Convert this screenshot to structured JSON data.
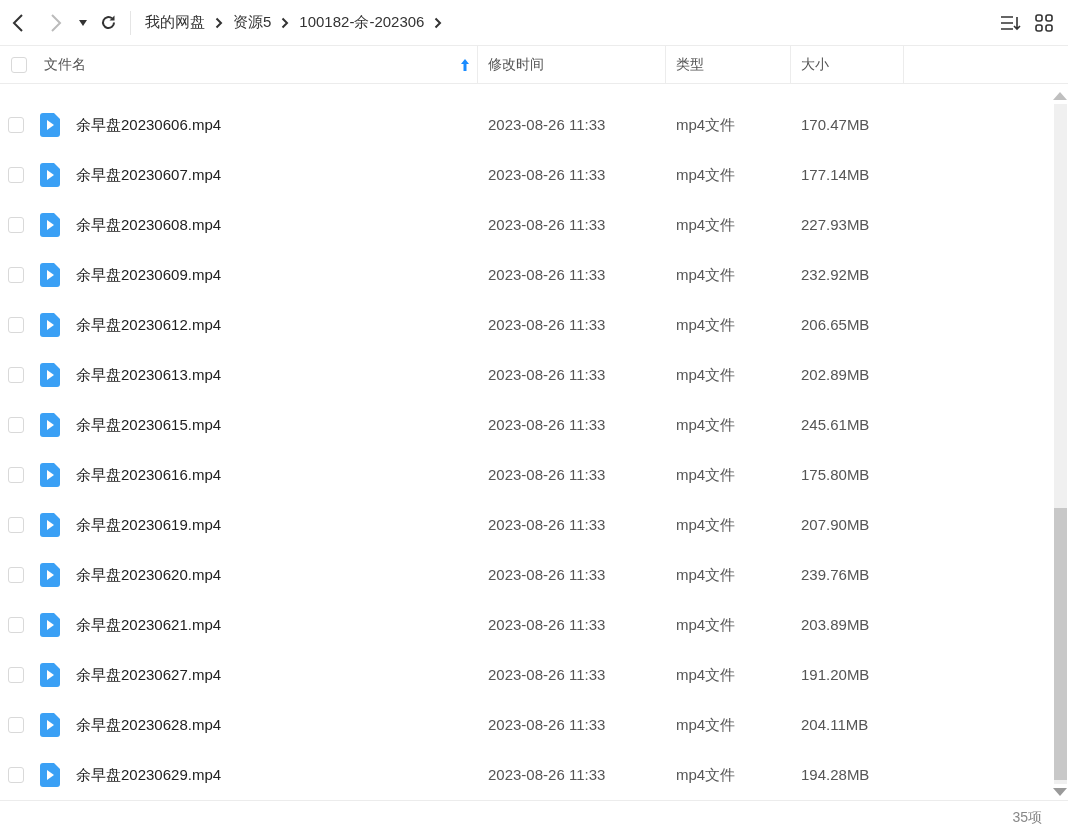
{
  "breadcrumb": [
    "我的网盘",
    "资源5",
    "100182-余-202306"
  ],
  "select_all": {
    "checked": false
  },
  "columns": [
    {
      "label": "文件名",
      "sorted": true
    },
    {
      "label": "修改时间",
      "sorted": false
    },
    {
      "label": "类型",
      "sorted": false
    },
    {
      "label": "大小",
      "sorted": false
    }
  ],
  "rows": [
    {
      "name": "余早盘20230606.mp4",
      "modified": "2023-08-26 11:33",
      "type": "mp4文件",
      "size": "170.47MB",
      "checked": false
    },
    {
      "name": "余早盘20230607.mp4",
      "modified": "2023-08-26 11:33",
      "type": "mp4文件",
      "size": "177.14MB",
      "checked": false
    },
    {
      "name": "余早盘20230608.mp4",
      "modified": "2023-08-26 11:33",
      "type": "mp4文件",
      "size": "227.93MB",
      "checked": false
    },
    {
      "name": "余早盘20230609.mp4",
      "modified": "2023-08-26 11:33",
      "type": "mp4文件",
      "size": "232.92MB",
      "checked": false
    },
    {
      "name": "余早盘20230612.mp4",
      "modified": "2023-08-26 11:33",
      "type": "mp4文件",
      "size": "206.65MB",
      "checked": false
    },
    {
      "name": "余早盘20230613.mp4",
      "modified": "2023-08-26 11:33",
      "type": "mp4文件",
      "size": "202.89MB",
      "checked": false
    },
    {
      "name": "余早盘20230615.mp4",
      "modified": "2023-08-26 11:33",
      "type": "mp4文件",
      "size": "245.61MB",
      "checked": false
    },
    {
      "name": "余早盘20230616.mp4",
      "modified": "2023-08-26 11:33",
      "type": "mp4文件",
      "size": "175.80MB",
      "checked": false
    },
    {
      "name": "余早盘20230619.mp4",
      "modified": "2023-08-26 11:33",
      "type": "mp4文件",
      "size": "207.90MB",
      "checked": false
    },
    {
      "name": "余早盘20230620.mp4",
      "modified": "2023-08-26 11:33",
      "type": "mp4文件",
      "size": "239.76MB",
      "checked": false
    },
    {
      "name": "余早盘20230621.mp4",
      "modified": "2023-08-26 11:33",
      "type": "mp4文件",
      "size": "203.89MB",
      "checked": false
    },
    {
      "name": "余早盘20230627.mp4",
      "modified": "2023-08-26 11:33",
      "type": "mp4文件",
      "size": "191.20MB",
      "checked": false
    },
    {
      "name": "余早盘20230628.mp4",
      "modified": "2023-08-26 11:33",
      "type": "mp4文件",
      "size": "204.11MB",
      "checked": false
    },
    {
      "name": "余早盘20230629.mp4",
      "modified": "2023-08-26 11:33",
      "type": "mp4文件",
      "size": "194.28MB",
      "checked": false
    }
  ],
  "status_bar": {
    "count": "35项"
  }
}
